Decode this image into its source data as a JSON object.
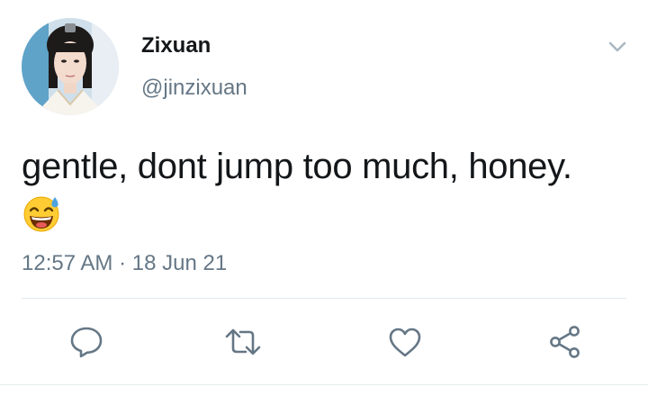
{
  "user": {
    "display_name": "Zixuan",
    "handle": "@jinzixuan"
  },
  "tweet": {
    "text": "gentle, dont jump too much, honey.",
    "emoji": "grinning-face-with-sweat-emoji",
    "time": "12:57 AM",
    "separator": "·",
    "date": "18 Jun 21"
  },
  "actions": [
    {
      "name": "reply",
      "icon": "speech-bubble-icon"
    },
    {
      "name": "retweet",
      "icon": "retweet-arrows-icon"
    },
    {
      "name": "like",
      "icon": "heart-icon"
    },
    {
      "name": "share",
      "icon": "share-nodes-icon"
    }
  ],
  "colors": {
    "text_primary": "#14171a",
    "text_secondary": "#657786",
    "divider": "#e1e8ed",
    "icon": "#657786"
  }
}
